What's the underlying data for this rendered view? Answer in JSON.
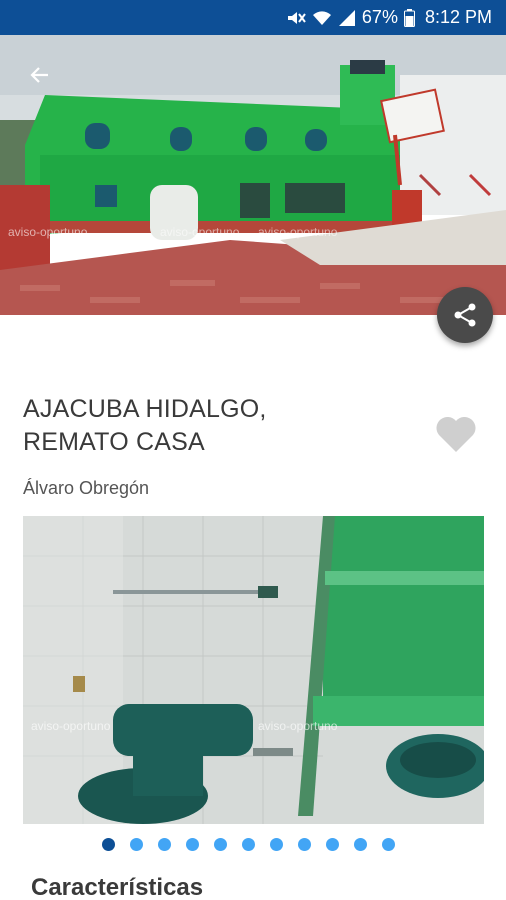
{
  "status_bar": {
    "battery": "67%",
    "time": "8:12 PM",
    "icons": [
      "mute-icon",
      "wifi-icon",
      "signal-icon",
      "battery-icon"
    ]
  },
  "listing": {
    "title_line1": "AJACUBA HIDALGO,",
    "title_line2": "REMATO CASA",
    "location": "Álvaro Obregón"
  },
  "hero": {
    "watermark_left": "aviso-oportuno",
    "watermark_mid": "aviso-oportuno",
    "watermark_right": "aviso-oportuno"
  },
  "gallery": {
    "watermark_left": "aviso-oportuno",
    "watermark_right": "aviso-oportuno",
    "slide_count": 11,
    "active_index": 0
  },
  "sections": {
    "features_title": "Características"
  },
  "colors": {
    "status_bar": "#0d4f96",
    "dot_active": "#0d4f96",
    "dot_inactive": "#42a5f5",
    "share_fab": "#4a4a4a",
    "heart": "#cfcfcf"
  }
}
